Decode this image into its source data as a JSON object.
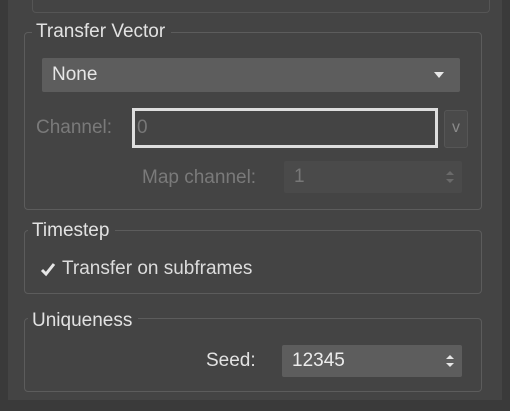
{
  "transfer_vector": {
    "title": "Transfer Vector",
    "dropdown_value": "None",
    "channel_label": "Channel:",
    "channel_value": "0",
    "v_button": "v",
    "map_channel_label": "Map channel:",
    "map_channel_value": "1"
  },
  "timestep": {
    "title": "Timestep",
    "checkbox_label": "Transfer on subframes",
    "checked": true
  },
  "uniqueness": {
    "title": "Uniqueness",
    "seed_label": "Seed:",
    "seed_value": "12345"
  }
}
